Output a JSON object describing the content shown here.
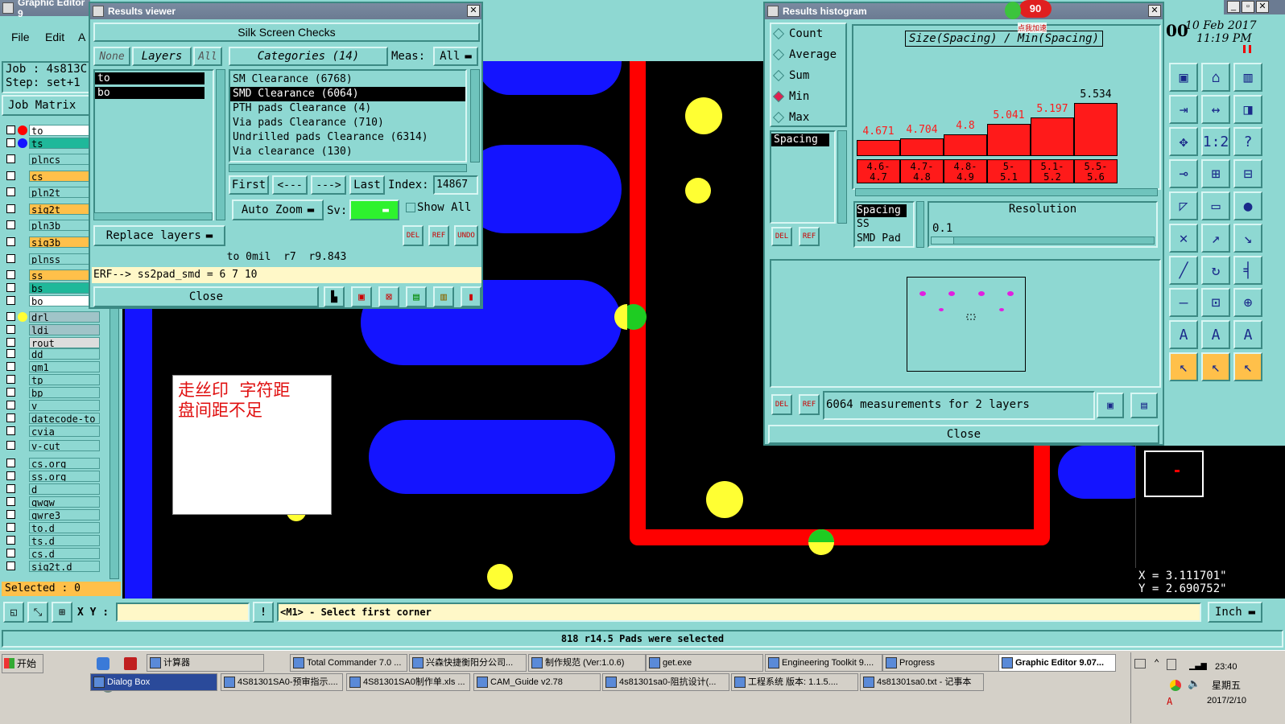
{
  "graphic_editor": {
    "title": "Graphic Editor 9",
    "menu": [
      "File",
      "Edit",
      "A"
    ],
    "job_label": "Job : 4s813C",
    "step_label": "Step: set+1",
    "job_matrix": "Job Matrix",
    "layers": [
      "to",
      "ts",
      "plncs",
      "cs",
      "pln2t",
      "sig2t",
      "pln3b",
      "sig3b",
      "plnss",
      "ss",
      "bs",
      "bo",
      "drl",
      "ldi",
      "rout",
      "dd",
      "gm1",
      "tp",
      "bp",
      "v",
      "datecode-to",
      "cvia",
      "v-cut",
      "cs.org",
      "ss.org",
      "d",
      "qwqw",
      "qwre3",
      "to.d",
      "ts.d",
      "cs.d",
      "sig2t.d"
    ],
    "selected": "Selected : 0",
    "date": "10 Feb 2017",
    "time": "11:19 PM",
    "date_prefix": "00",
    "coord_x": "X = 3.111701\"",
    "coord_y": "Y = 2.690752\"",
    "xy_label": "X Y :",
    "prompt": "<M1> - Select first corner",
    "units": "Inch",
    "status": "818 r14.5 Pads were selected",
    "annotation_line1": "走丝印  字符距",
    "annotation_line2": "盘间距不足",
    "colors": {
      "copper": "#1414ff",
      "outline": "#ff0000",
      "pad": "#ffff33",
      "bg": "#000000"
    }
  },
  "results_viewer": {
    "title": "Results viewer",
    "header": "Silk Screen Checks",
    "none": "None",
    "layers": "Layers",
    "all": "All",
    "layer_items": [
      "to",
      "bo"
    ],
    "categories": "Categories (14)",
    "meas_label": "Meas:",
    "meas_value": "All",
    "category_items": [
      "SM Clearance (6768)",
      "SMD Clearance (6064)",
      "PTH pads Clearance (4)",
      "Via pads Clearance (710)",
      "Undrilled pads Clearance (6314)",
      "Via clearance (130)"
    ],
    "selected_category": 1,
    "first": "First",
    "prev": "<---",
    "next": "--->",
    "last": "Last",
    "index_label": "Index:",
    "index_value": "14867",
    "auto_zoom": "Auto Zoom",
    "sv": "Sv:",
    "show_all": "Show All",
    "replace_layers": "Replace layers",
    "del": "DEL",
    "ref": "REF",
    "undo": "UNDO",
    "info": "to 0mil  r7  r9.843",
    "erf": "ERF--> ss2pad_smd = 6 7 10",
    "close": "Close"
  },
  "results_histogram": {
    "title": "Results histogram",
    "options": [
      "Count",
      "Average",
      "Sum",
      "Min",
      "Max"
    ],
    "selected_option": "Min",
    "chart_title": "Size(Spacing) / Min(Spacing)",
    "spacing_item": "Spacing",
    "badge": "90",
    "badge_sub": "点我加速",
    "chart_data": {
      "type": "bar",
      "categories": [
        "4.6-4.7",
        "4.7-4.8",
        "4.8-4.9",
        "5-5.1",
        "5.1-5.2",
        "5.5-5.6"
      ],
      "values": [
        4.671,
        4.704,
        4.8,
        5.041,
        5.197,
        5.534
      ],
      "labels": [
        "4.671",
        "4.704",
        "4.8",
        "5.041",
        "5.197",
        "5.534"
      ]
    },
    "bucket_labels": [
      [
        "4.6-",
        "4.7"
      ],
      [
        "4.7-",
        "4.8"
      ],
      [
        "4.8-",
        "4.9"
      ],
      [
        "5-",
        "5.1"
      ],
      [
        "5.1-",
        "5.2"
      ],
      [
        "5.5-",
        "5.6"
      ]
    ],
    "attr_list": [
      "Spacing",
      "SS",
      "SMD Pad"
    ],
    "resolution_label": "Resolution",
    "resolution_value": "0.1",
    "del": "DEL",
    "ref": "REF",
    "measurements": "6064 measurements for 2 layers",
    "close": "Close"
  },
  "taskbar": {
    "start": "开始",
    "row1": [
      "计算器",
      "Total Commander 7.0 ...",
      "兴森快捷衡阳分公司...",
      "制作规范 (Ver:1.0.6)",
      "get.exe",
      "Engineering Toolkit 9....",
      "Progress",
      "Graphic Editor 9.07..."
    ],
    "row2": [
      "Dialog Box",
      "4S81301SA0-预审指示....",
      "4S81301SA0制作单.xls ...",
      "CAM_Guide v2.78",
      "4s81301sa0-阻抗设计(...",
      "工程系统  版本: 1.1.5....",
      "4s81301sa0.txt - 记事本"
    ],
    "clock_time": "23:40",
    "clock_day": "星期五",
    "clock_date": "2017/2/10"
  }
}
